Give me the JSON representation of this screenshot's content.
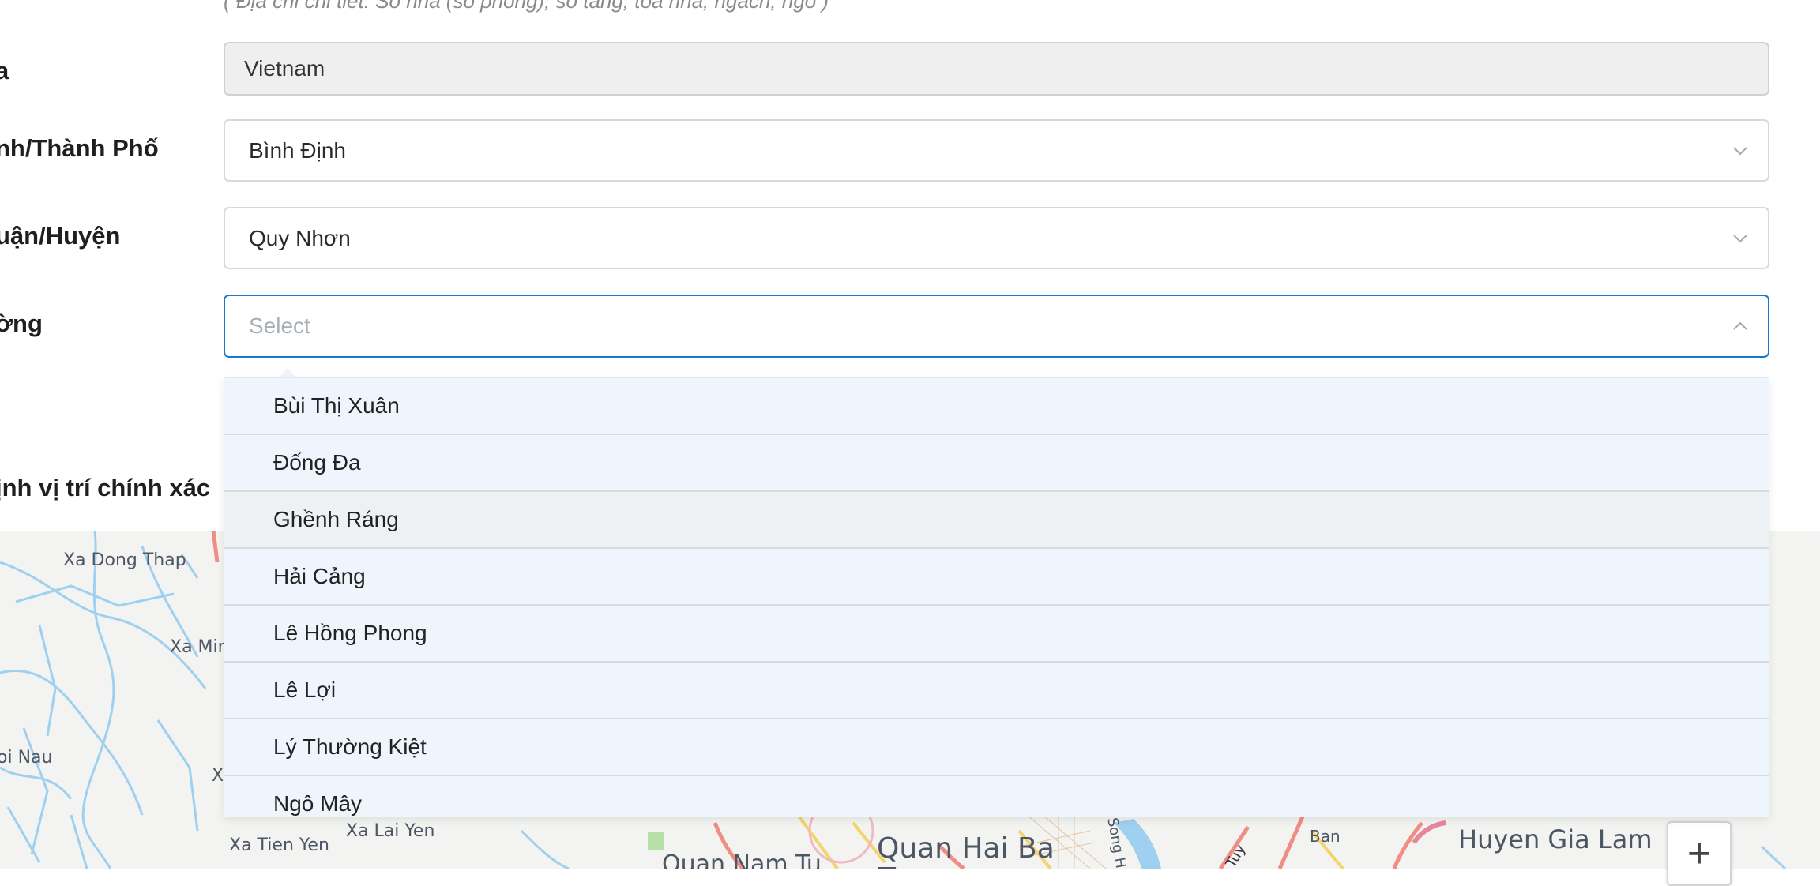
{
  "address_hint": "( Địa chỉ chi tiết: Số nhà (số phòng), số tầng, tòa nhà, ngách, ngõ )",
  "country": {
    "label": "a",
    "value": "Vietnam"
  },
  "province": {
    "label": "nh/Thành Phố",
    "value": "Bình Định"
  },
  "district": {
    "label": "uận/Huyện",
    "value": "Quy Nhơn"
  },
  "ward": {
    "label": "ờng",
    "placeholder": "Select",
    "options": [
      "Bùi Thị Xuân",
      "Đống Đa",
      "Ghềnh Ráng",
      "Hải Cảng",
      "Lê Hồng Phong",
      "Lê Lợi",
      "Lý Thường Kiệt",
      "Ngô Mây"
    ]
  },
  "map_section": {
    "label": "ịnh vị trí chính xác"
  },
  "map": {
    "labels": [
      "Xa Dong Thap",
      "Xa Min",
      "oi Nau",
      "X",
      "Xa Tien Yen",
      "Xa Lai Yen",
      "Quan Nam Tu",
      "Quan Hai Ba",
      "Trung",
      "Song H",
      "Tuy",
      "Ban",
      "Huyen Gia Lam"
    ],
    "zoom_in": "+"
  },
  "colors": {
    "accent": "#1b78c9",
    "water": "#9fd0f0",
    "road": "#f08e86"
  }
}
